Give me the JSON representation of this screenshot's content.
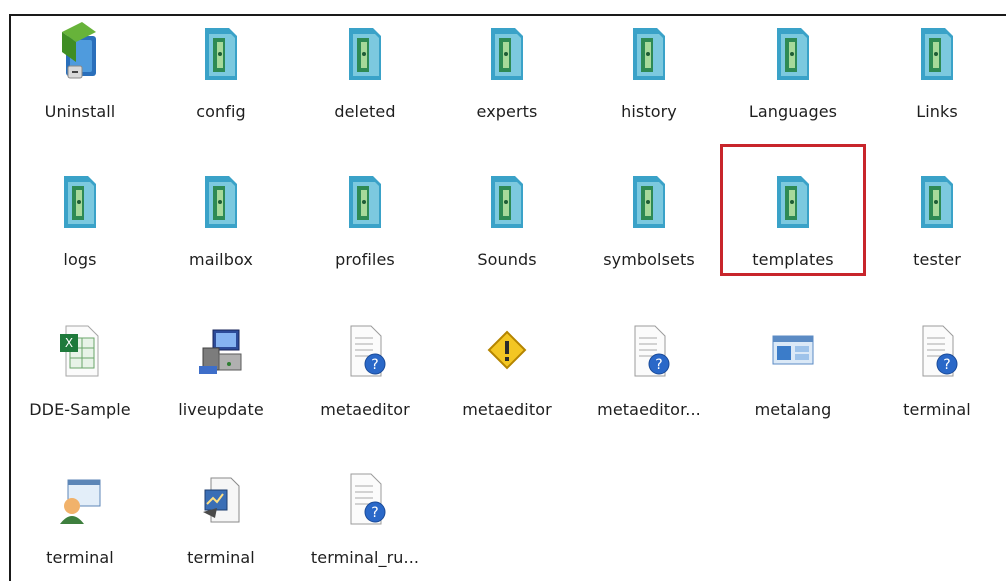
{
  "explorer": {
    "items": [
      {
        "label": "Uninstall",
        "icon": "uninstall-icon"
      },
      {
        "label": "config",
        "icon": "folder-icon"
      },
      {
        "label": "deleted",
        "icon": "folder-icon"
      },
      {
        "label": "experts",
        "icon": "folder-icon"
      },
      {
        "label": "history",
        "icon": "folder-icon"
      },
      {
        "label": "Languages",
        "icon": "folder-icon"
      },
      {
        "label": "Links",
        "icon": "folder-icon"
      },
      {
        "label": "logs",
        "icon": "folder-icon"
      },
      {
        "label": "mailbox",
        "icon": "folder-icon"
      },
      {
        "label": "profiles",
        "icon": "folder-icon"
      },
      {
        "label": "Sounds",
        "icon": "folder-icon"
      },
      {
        "label": "symbolsets",
        "icon": "folder-icon"
      },
      {
        "label": "templates",
        "icon": "folder-icon"
      },
      {
        "label": "tester",
        "icon": "folder-icon"
      },
      {
        "label": "DDE-Sample",
        "icon": "excel-file-icon"
      },
      {
        "label": "liveupdate",
        "icon": "liveupdate-icon"
      },
      {
        "label": "metaeditor",
        "icon": "help-file-icon"
      },
      {
        "label": "metaeditor",
        "icon": "warning-icon"
      },
      {
        "label": "metaeditor...",
        "icon": "help-file-icon"
      },
      {
        "label": "metalang",
        "icon": "window-app-icon"
      },
      {
        "label": "terminal",
        "icon": "help-file-icon"
      },
      {
        "label": "terminal",
        "icon": "user-terminal-icon"
      },
      {
        "label": "terminal",
        "icon": "terminal-app-icon"
      },
      {
        "label": "terminal_ru...",
        "icon": "help-file-icon"
      }
    ],
    "selected_label": "templates",
    "highlight_color": "#c8252b"
  }
}
